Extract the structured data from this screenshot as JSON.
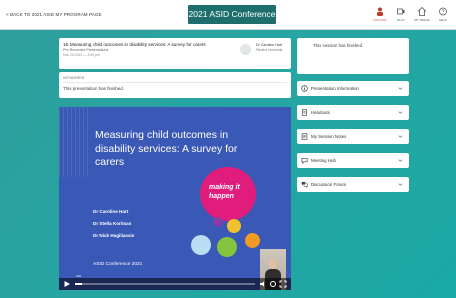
{
  "topbar": {
    "back_label": "< BACK TO 2021 ASID MY PROGRAM PAGE",
    "conference_title": "2021 ASID Conference",
    "actions": [
      {
        "label": "LOG OUT",
        "icon": "logout-icon"
      },
      {
        "label": "PLAY",
        "icon": "video-icon"
      },
      {
        "label": "MY SPACE",
        "icon": "home-icon"
      },
      {
        "label": "HELP",
        "icon": "help-icon"
      }
    ]
  },
  "session": {
    "title": "1E Measuring child outcomes in disability services: A survey for carers",
    "type": "Pre-Recorded Presentations",
    "time": "Dec 10 2021 — 2:00 pm",
    "chair_label": "Dr Caroline Hart",
    "chair_name": "Flinders University"
  },
  "keywords": {
    "heading": "KEYWORDS",
    "text": "This presentation has finished."
  },
  "video": {
    "slide_title": "Measuring child outcomes in disability services: A survey for carers",
    "authors": [
      "Dr Caroline Hart",
      "Dr Stella Koritsas",
      "Dr Nick Hagiliassis"
    ],
    "footer": "ASID Conference 2021",
    "brand": "making it happen",
    "time_readout": "0:00",
    "progress": 0.04
  },
  "sidebar": {
    "notice": "This session has finished",
    "panels": [
      {
        "label": "Presentation Information",
        "icon": "info-icon"
      },
      {
        "label": "Handouts",
        "icon": "document-icon"
      },
      {
        "label": "My Session Notes",
        "icon": "notes-icon"
      },
      {
        "label": "Meeting Hub",
        "icon": "chat-icon"
      },
      {
        "label": "Discussion Forum",
        "icon": "forum-icon"
      }
    ]
  },
  "colors": {
    "background": "#27a5a3",
    "title_bg": "#1d6e6c",
    "slide_bg": "#3a58b5",
    "brand_pink": "#e01d7c",
    "logout_red": "#c0392b"
  }
}
